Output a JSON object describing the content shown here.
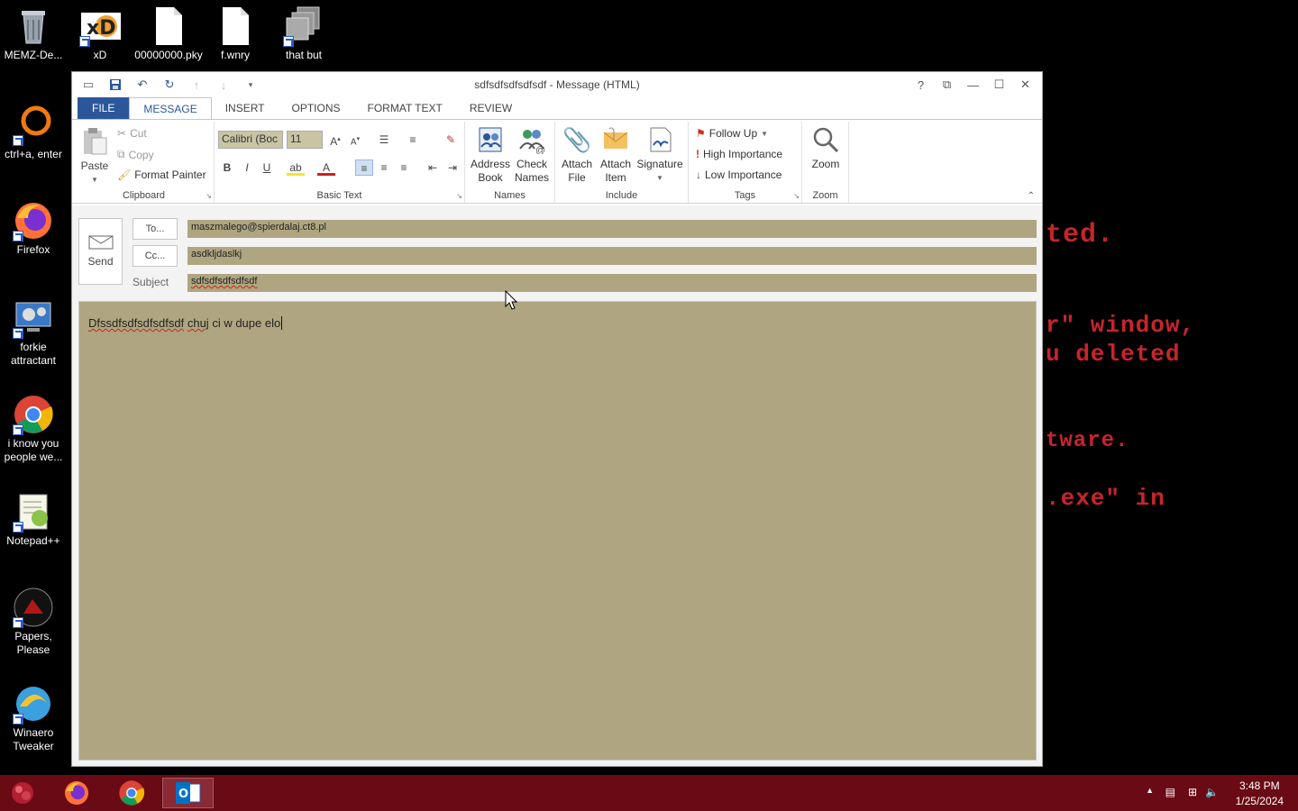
{
  "desktop": {
    "background_text": [
      "ted.",
      "r\" window,",
      "u deleted",
      "tware.",
      ".exe\" in"
    ],
    "icons": [
      {
        "label": "MEMZ-De..."
      },
      {
        "label": "xD"
      },
      {
        "label": "00000000.pky"
      },
      {
        "label": "f.wnry"
      },
      {
        "label": "that but"
      },
      {
        "label": "ctrl+a, enter"
      },
      {
        "label": "Firefox"
      },
      {
        "label": "forkie attractant"
      },
      {
        "label": "i know you people we..."
      },
      {
        "label": "Notepad++"
      },
      {
        "label": "Papers, Please"
      },
      {
        "label": "Winaero Tweaker"
      }
    ]
  },
  "window": {
    "title": "sdfsdfsdfsdfsdf - Message (HTML)",
    "controls": {
      "help": "?",
      "restore_ribbon": "⧉",
      "minimize": "—",
      "maximize": "☐",
      "close": "✕"
    },
    "tabs": [
      "FILE",
      "MESSAGE",
      "INSERT",
      "OPTIONS",
      "FORMAT TEXT",
      "REVIEW"
    ],
    "active_tab": "MESSAGE",
    "ribbon": {
      "clipboard": {
        "label": "Clipboard",
        "paste": "Paste",
        "cut": "Cut",
        "copy": "Copy",
        "format_painter": "Format Painter"
      },
      "basic_text": {
        "label": "Basic Text",
        "font": "Calibri (Boc",
        "size": "11",
        "bold": "B",
        "italic": "I",
        "underline": "U"
      },
      "names": {
        "label": "Names",
        "address_book_1": "Address",
        "address_book_2": "Book",
        "check_names_1": "Check",
        "check_names_2": "Names"
      },
      "include": {
        "label": "Include",
        "attach_file_1": "Attach",
        "attach_file_2": "File",
        "attach_item_1": "Attach",
        "attach_item_2": "Item",
        "signature": "Signature"
      },
      "tags": {
        "label": "Tags",
        "follow_up": "Follow Up",
        "high": "High Importance",
        "low": "Low Importance"
      },
      "zoom": {
        "label": "Zoom",
        "zoom": "Zoom"
      }
    },
    "compose": {
      "send": "Send",
      "to_button": "To...",
      "cc_button": "Cc...",
      "subject_label": "Subject",
      "to_value": "maszmalego@spierdalaj.ct8.pl",
      "cc_value": "asdkljdaslkj",
      "subject_value": "sdfsdfsdfsdfsdf",
      "body_word1": "Dfssdfsdfsdfsdfsdf",
      "body_word2": "chuj",
      "body_rest": " ci w dupe elo"
    }
  },
  "taskbar": {
    "time": "3:48 PM",
    "date": "1/25/2024"
  },
  "colors": {
    "accent": "#2b579a",
    "field_bg": "#afa681",
    "taskbar": "#6a0a14",
    "bg_text": "#c8242c"
  }
}
